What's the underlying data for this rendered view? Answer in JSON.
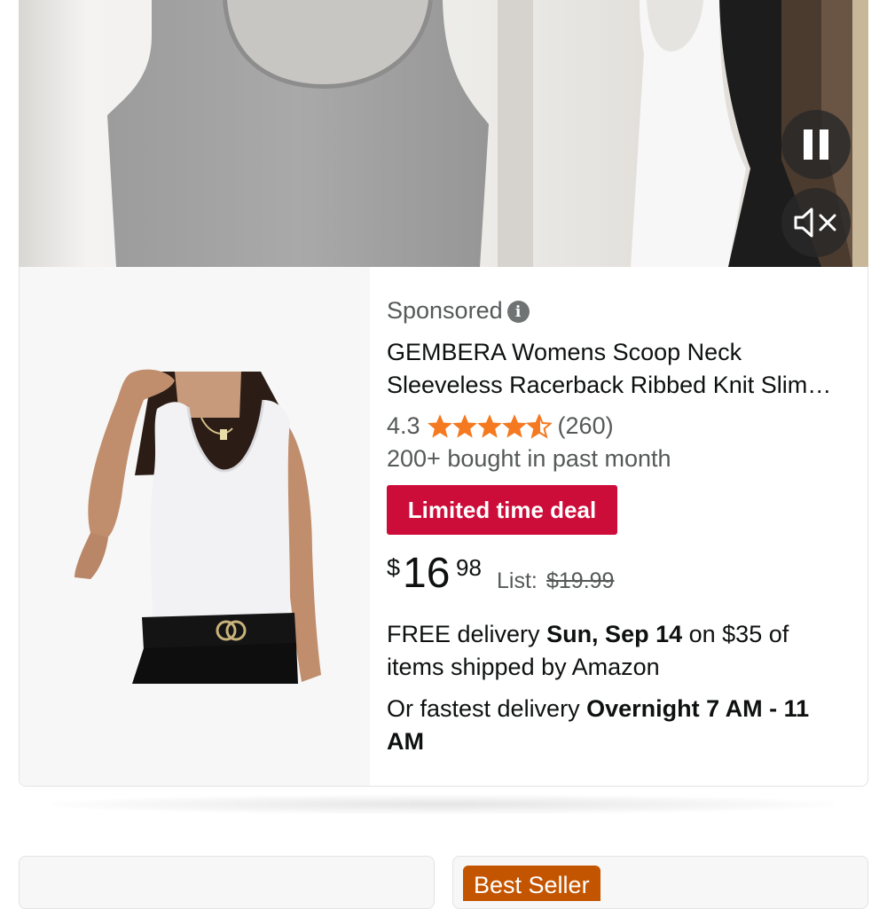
{
  "video": {
    "pause_icon": "pause-icon",
    "mute_icon": "speaker-muted-icon"
  },
  "product": {
    "sponsored_label": "Sponsored",
    "info_icon_glyph": "i",
    "title": "GEMBERA Womens Scoop Neck Sleeveless Racerback Ribbed Knit Slim…",
    "rating_value": "4.3",
    "rating_stars": 4.3,
    "review_count": "(260)",
    "bought_text": "200+ bought in past month",
    "deal_badge": "Limited time deal",
    "price_currency": "$",
    "price_whole": "16",
    "price_fraction": "98",
    "list_label": "List:",
    "list_price": "$19.99",
    "delivery_prefix": "FREE delivery ",
    "delivery_date": "Sun, Sep 14",
    "delivery_suffix": " on $35 of items shipped by Amazon",
    "fastest_prefix": "Or fastest delivery ",
    "fastest_window": "Overnight 7 AM - 11 AM"
  },
  "next_row": {
    "badge": "Best Seller"
  },
  "colors": {
    "deal_red": "#cc0c39",
    "star_orange": "#f47920",
    "best_seller_orange": "#c45500"
  }
}
